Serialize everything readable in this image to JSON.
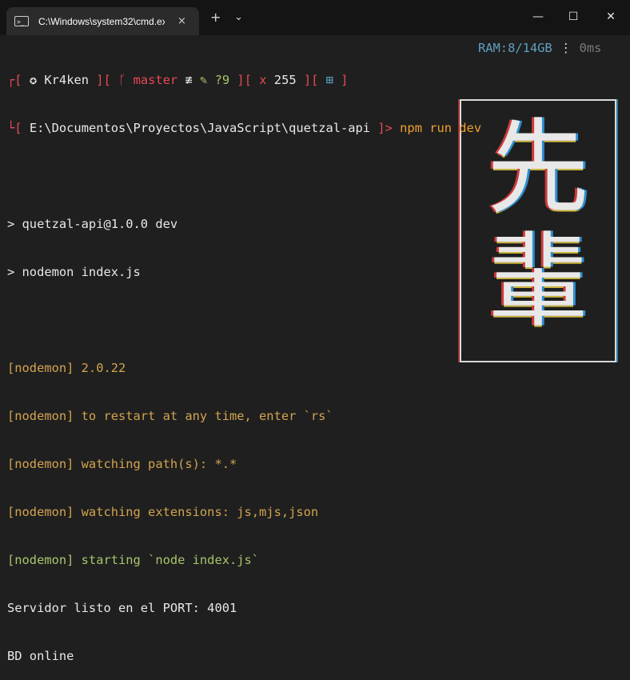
{
  "window": {
    "tab_title": "C:\\Windows\\system32\\cmd.ex",
    "tab_icon_glyph": ">_",
    "tab_close": "×",
    "new_tab": "+",
    "dropdown": "⌄",
    "minimize": "—",
    "maximize": "☐",
    "close": "✕"
  },
  "prompt": {
    "bracket_open": "┌[",
    "user_icon": "✪",
    "user": "Kr4ken",
    "sep1": " ][ ",
    "branch_icon": "ᚴ",
    "branch": "master",
    "branch_status": "≢",
    "stash_icon": "✎",
    "changes": "?9",
    "sep2": " ][ ",
    "exit_icon": "x",
    "exit_code": "255",
    "sep3": " ][ ",
    "os_icon": "⊞",
    "bracket_close": " ]",
    "corner2": "└[",
    "path": "E:\\Documentos\\Proyectos\\JavaScript\\quetzal-api",
    "path_close": " ]>",
    "command": "npm run dev",
    "ram": "RAM:8/14GB",
    "divider": "⋮",
    "time": "0ms"
  },
  "output": {
    "line1": "> quetzal-api@1.0.0 dev",
    "line2": "> nodemon index.js",
    "nodemon_version": "[nodemon] 2.0.22",
    "nodemon_restart": "[nodemon] to restart at any time, enter `rs`",
    "nodemon_watch_path": "[nodemon] watching path(s): *.*",
    "nodemon_watch_ext": "[nodemon] watching extensions: js,mjs,json",
    "nodemon_starting": "[nodemon] starting `node index.js`",
    "server_ready": "Servidor listo en el PORT: 4001",
    "db_status": "BD online"
  },
  "background_art": {
    "kanji_top": "先",
    "kanji_bottom": "輩"
  }
}
